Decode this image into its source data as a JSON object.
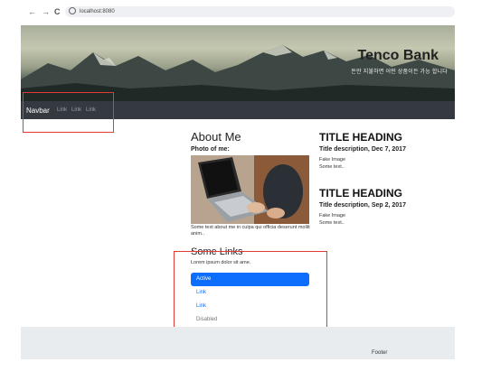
{
  "browser": {
    "back": "←",
    "forward": "→",
    "reload": "C",
    "url": "localhost:8080"
  },
  "hero": {
    "brand": "Tenco Bank",
    "tagline": "돈만 지불하면 어떤 상품이든 가능 합니다"
  },
  "navbar": {
    "brand": "Navbar",
    "links": [
      "Link",
      "Link",
      "Link"
    ]
  },
  "about": {
    "heading": "About Me",
    "photo_label": "Photo of me:",
    "text": "Some text about me in culpa qui officia deserunt mollit anim.."
  },
  "links_section": {
    "heading": "Some Links",
    "text": "Lorem ipsum dolor sit ame.",
    "items": [
      "Active",
      "Link",
      "Link",
      "Disabled"
    ]
  },
  "posts": [
    {
      "title": "TITLE HEADING",
      "description": "Title description, Dec 7, 2017",
      "image": "Fake Image",
      "text": "Some text.."
    },
    {
      "title": "TITLE HEADING",
      "description": "Title description, Sep 2, 2017",
      "image": "Fake Image",
      "text": "Some text.."
    }
  ],
  "footer": {
    "text": "Footer"
  },
  "colors": {
    "navbar": "#343a40",
    "active": "#0d6efd",
    "highlight": "#e53935",
    "footer": "#e9ecef"
  }
}
